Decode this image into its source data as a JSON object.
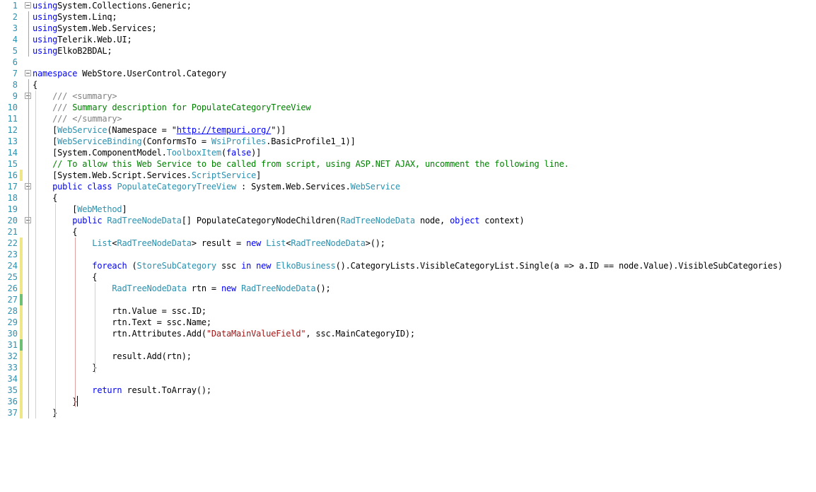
{
  "editor": {
    "lines": [
      {
        "n": "1",
        "fold": true,
        "change": "",
        "indent": "",
        "tokens": [
          [
            "kw",
            "using"
          ],
          [
            "",
            "System.Collections.Generic;"
          ]
        ]
      },
      {
        "n": "2",
        "fold": false,
        "change": "",
        "indent": "",
        "tokens": [
          [
            "kw",
            "using"
          ],
          [
            "",
            "System.Linq;"
          ]
        ]
      },
      {
        "n": "3",
        "fold": false,
        "change": "",
        "indent": "",
        "tokens": [
          [
            "kw",
            "using"
          ],
          [
            "",
            "System.Web.Services;"
          ]
        ]
      },
      {
        "n": "4",
        "fold": false,
        "change": "",
        "indent": "",
        "tokens": [
          [
            "kw",
            "using"
          ],
          [
            "",
            "Telerik.Web.UI;"
          ]
        ]
      },
      {
        "n": "5",
        "fold": false,
        "change": "",
        "indent": "",
        "tokens": [
          [
            "kw",
            "using"
          ],
          [
            "",
            "ElkoB2BDAL;"
          ]
        ]
      },
      {
        "n": "6",
        "fold": false,
        "change": "",
        "indent": "",
        "tokens": []
      },
      {
        "n": "7",
        "fold": true,
        "change": "",
        "indent": "",
        "tokens": [
          [
            "kw",
            "namespace"
          ],
          [
            "",
            " WebStore.UserControl.Category"
          ]
        ]
      },
      {
        "n": "8",
        "fold": false,
        "change": "",
        "indent": "",
        "tokens": [
          [
            "",
            "{"
          ]
        ]
      },
      {
        "n": "9",
        "fold": true,
        "change": "",
        "indent": "    ",
        "tokens": [
          [
            "cg",
            "/// <summary>"
          ]
        ]
      },
      {
        "n": "10",
        "fold": false,
        "change": "",
        "indent": "    ",
        "tokens": [
          [
            "cg",
            "/// "
          ],
          [
            "cm",
            "Summary description for PopulateCategoryTreeView"
          ]
        ]
      },
      {
        "n": "11",
        "fold": false,
        "change": "",
        "indent": "    ",
        "tokens": [
          [
            "cg",
            "/// </summary>"
          ]
        ]
      },
      {
        "n": "12",
        "fold": false,
        "change": "",
        "indent": "    ",
        "tokens": [
          [
            "",
            "["
          ],
          [
            "ty",
            "WebService"
          ],
          [
            "",
            "(Namespace = \""
          ],
          [
            "url",
            "http://tempuri.org/"
          ],
          [
            "",
            "\")]"
          ]
        ]
      },
      {
        "n": "13",
        "fold": false,
        "change": "",
        "indent": "    ",
        "tokens": [
          [
            "",
            "["
          ],
          [
            "ty",
            "WebServiceBinding"
          ],
          [
            "",
            "(ConformsTo = "
          ],
          [
            "ty",
            "WsiProfiles"
          ],
          [
            "",
            ".BasicProfile1_1)]"
          ]
        ]
      },
      {
        "n": "14",
        "fold": false,
        "change": "",
        "indent": "    ",
        "tokens": [
          [
            "",
            "[System.ComponentModel."
          ],
          [
            "ty",
            "ToolboxItem"
          ],
          [
            "",
            "("
          ],
          [
            "kw",
            "false"
          ],
          [
            "",
            ")]"
          ]
        ]
      },
      {
        "n": "15",
        "fold": false,
        "change": "",
        "indent": "    ",
        "tokens": [
          [
            "cm",
            "// To allow this Web Service to be called from script, using ASP.NET AJAX, uncomment the following line."
          ]
        ]
      },
      {
        "n": "16",
        "fold": false,
        "change": "yellow",
        "indent": "    ",
        "tokens": [
          [
            "",
            "[System.Web.Script.Services."
          ],
          [
            "ty",
            "ScriptService"
          ],
          [
            "",
            "]"
          ]
        ]
      },
      {
        "n": "17",
        "fold": true,
        "change": "",
        "indent": "    ",
        "tokens": [
          [
            "kw",
            "public class "
          ],
          [
            "ty",
            "PopulateCategoryTreeView"
          ],
          [
            "",
            " : System.Web.Services."
          ],
          [
            "ty",
            "WebService"
          ]
        ]
      },
      {
        "n": "18",
        "fold": false,
        "change": "",
        "indent": "    ",
        "tokens": [
          [
            "",
            "{"
          ]
        ]
      },
      {
        "n": "19",
        "fold": false,
        "change": "",
        "indent": "        ",
        "tokens": [
          [
            "",
            "["
          ],
          [
            "ty",
            "WebMethod"
          ],
          [
            "",
            "]"
          ]
        ]
      },
      {
        "n": "20",
        "fold": true,
        "change": "",
        "indent": "        ",
        "tokens": [
          [
            "kw",
            "public "
          ],
          [
            "ty",
            "RadTreeNodeData"
          ],
          [
            "",
            "[] PopulateCategoryNodeChildren("
          ],
          [
            "ty",
            "RadTreeNodeData"
          ],
          [
            "",
            " node, "
          ],
          [
            "kw",
            "object"
          ],
          [
            "",
            " context)"
          ]
        ]
      },
      {
        "n": "21",
        "fold": false,
        "change": "",
        "indent": "        ",
        "tokens": [
          [
            "",
            "{"
          ]
        ]
      },
      {
        "n": "22",
        "fold": false,
        "change": "yellow",
        "indent": "            ",
        "tokens": [
          [
            "ty",
            "List"
          ],
          [
            "",
            "<"
          ],
          [
            "ty",
            "RadTreeNodeData"
          ],
          [
            "",
            "> result = "
          ],
          [
            "kw",
            "new "
          ],
          [
            "ty",
            "List"
          ],
          [
            "",
            "<"
          ],
          [
            "ty",
            "RadTreeNodeData"
          ],
          [
            "",
            ">();"
          ]
        ]
      },
      {
        "n": "23",
        "fold": false,
        "change": "yellow",
        "indent": "",
        "tokens": []
      },
      {
        "n": "24",
        "fold": false,
        "change": "yellow",
        "indent": "            ",
        "tokens": [
          [
            "kw",
            "foreach"
          ],
          [
            "",
            " ("
          ],
          [
            "ty",
            "StoreSubCategory"
          ],
          [
            "",
            " ssc "
          ],
          [
            "kw",
            "in new "
          ],
          [
            "ty",
            "ElkoBusiness"
          ],
          [
            "",
            "().CategoryLists.VisibleCategoryList.Single(a => a.ID == node.Value).VisibleSubCategories)"
          ]
        ]
      },
      {
        "n": "25",
        "fold": false,
        "change": "yellow",
        "indent": "            ",
        "tokens": [
          [
            "",
            "{"
          ]
        ]
      },
      {
        "n": "26",
        "fold": false,
        "change": "yellow",
        "indent": "                ",
        "tokens": [
          [
            "ty",
            "RadTreeNodeData"
          ],
          [
            "",
            " rtn = "
          ],
          [
            "kw",
            "new "
          ],
          [
            "ty",
            "RadTreeNodeData"
          ],
          [
            "",
            "();"
          ]
        ]
      },
      {
        "n": "27",
        "fold": false,
        "change": "green",
        "indent": "",
        "tokens": []
      },
      {
        "n": "28",
        "fold": false,
        "change": "yellow",
        "indent": "                ",
        "tokens": [
          [
            "",
            "rtn.Value = ssc.ID;"
          ]
        ]
      },
      {
        "n": "29",
        "fold": false,
        "change": "yellow",
        "indent": "                ",
        "tokens": [
          [
            "",
            "rtn.Text = ssc.Name;"
          ]
        ]
      },
      {
        "n": "30",
        "fold": false,
        "change": "yellow",
        "indent": "                ",
        "tokens": [
          [
            "",
            "rtn.Attributes.Add("
          ],
          [
            "st",
            "\"DataMainValueField\""
          ],
          [
            "",
            ", ssc.MainCategoryID);"
          ]
        ]
      },
      {
        "n": "31",
        "fold": false,
        "change": "green",
        "indent": "",
        "tokens": []
      },
      {
        "n": "32",
        "fold": false,
        "change": "yellow",
        "indent": "                ",
        "tokens": [
          [
            "",
            "result.Add(rtn);"
          ]
        ]
      },
      {
        "n": "33",
        "fold": false,
        "change": "yellow",
        "indent": "            ",
        "tokens": [
          [
            "",
            "}"
          ]
        ]
      },
      {
        "n": "34",
        "fold": false,
        "change": "yellow",
        "indent": "",
        "tokens": []
      },
      {
        "n": "35",
        "fold": false,
        "change": "yellow",
        "indent": "            ",
        "tokens": [
          [
            "kw",
            "return"
          ],
          [
            "",
            " result.ToArray();"
          ]
        ]
      },
      {
        "n": "36",
        "fold": false,
        "change": "yellow",
        "indent": "        ",
        "tokens": [
          [
            "",
            "}"
          ]
        ]
      },
      {
        "n": "37",
        "fold": false,
        "change": "yellow",
        "indent": "    ",
        "tokens": [
          [
            "",
            "}"
          ]
        ]
      }
    ],
    "colors": {
      "keyword": "#0000ff",
      "type": "#2b91af",
      "comment": "#008000",
      "doc_comment_tag": "#808080",
      "string": "#a31515",
      "line_number": "#2b91af",
      "change_saved": "#6cbf73",
      "change_unsaved": "#efe787"
    }
  }
}
